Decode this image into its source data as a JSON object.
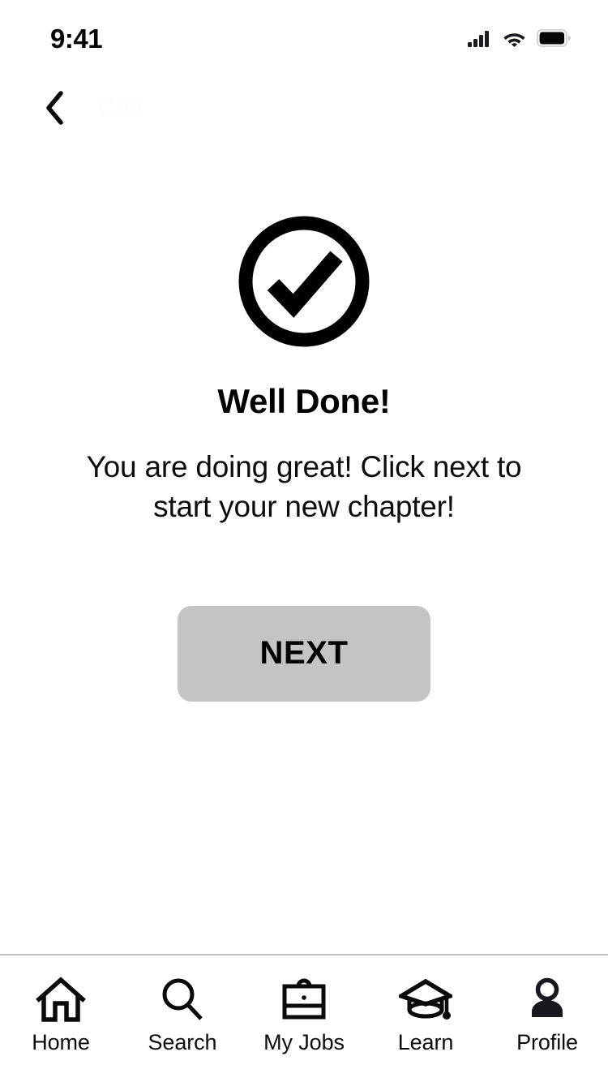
{
  "status_bar": {
    "time": "9:41",
    "icons": {
      "cellular": "signal-bars-icon",
      "wifi": "wifi-icon",
      "battery": "battery-full-icon"
    }
  },
  "nav_header": {
    "back_icon": "chevron-left-icon",
    "title": "Cart",
    "title_color": "#fcfcfc"
  },
  "main": {
    "success_icon": "check-circle-icon",
    "headline": "Well Done!",
    "subtext": "You are doing great! Click next to start your new chapter!",
    "next_button": {
      "label": "NEXT",
      "background": "#c4c4c4",
      "text_color": "#000000"
    }
  },
  "tab_bar": {
    "items": [
      {
        "label": "Home",
        "icon": "home-icon"
      },
      {
        "label": "Search",
        "icon": "search-icon"
      },
      {
        "label": "My Jobs",
        "icon": "briefcase-icon"
      },
      {
        "label": "Learn",
        "icon": "graduation-cap-icon"
      },
      {
        "label": "Profile",
        "icon": "person-icon"
      }
    ]
  },
  "colors": {
    "background": "#ffffff",
    "foreground": "#000000",
    "divider": "#bfbfbf",
    "button_gray": "#c4c4c4"
  }
}
